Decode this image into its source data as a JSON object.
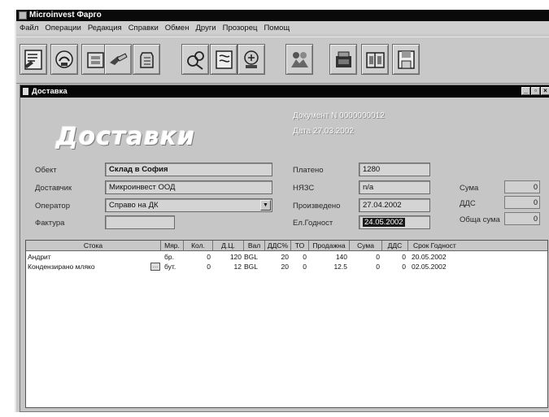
{
  "app": {
    "title": "Microinvest Фарго"
  },
  "menu": [
    "Файл",
    "Операции",
    "Редакция",
    "Справки",
    "Обмен",
    "Други",
    "Прозорец",
    "Помощ"
  ],
  "toolbar_icons": [
    "sales-icon",
    "delivery-icon",
    "refund-icon",
    "payment-icon",
    "stock-icon",
    "production-icon",
    "order-icon",
    "revision-icon",
    "partners-icon",
    "register-icon",
    "ledger-icon",
    "exit-icon"
  ],
  "window": {
    "title": "Доставка",
    "heading": "Доставки",
    "doc_number": "Документ N 0000000012",
    "doc_date": "Дата 27.03.2002"
  },
  "form": {
    "object_label": "Обект",
    "object_value": "Склад в София",
    "supplier_label": "Доставчик",
    "supplier_value": "Микроинвест ООД",
    "operator_label": "Оператор",
    "operator_value": "Справо на ДК",
    "invoice_label": "Фактура",
    "invoice_value": "",
    "paid_label": "Платено",
    "paid_value": "1280",
    "vat_label": "НЯЗС",
    "vat_value": "n/a",
    "produced_label": "Произведено",
    "produced_value": "27.04.2002",
    "valid_label": "Ел.Годност",
    "valid_value": "24.05.2002",
    "sum_label": "Сума",
    "sum_value": "0",
    "dds_label": "ДДС",
    "dds_value": "0",
    "total_label": "Обща сума",
    "total_value": "0"
  },
  "grid": {
    "columns": [
      "Стока",
      "Мяр.",
      "Кол.",
      "Д.Ц.",
      "Вал",
      "ДДС%",
      "ТО",
      "Продажна",
      "Сума",
      "ДДС",
      "Срок Годност"
    ],
    "rows": [
      [
        "Андрит",
        "бр.",
        "0",
        "120",
        "BGL",
        "20",
        "0",
        "140",
        "0",
        "0",
        "20.05.2002"
      ],
      [
        "Кондензирано мляко",
        "бут.",
        "0",
        "12",
        "BGL",
        "20",
        "0",
        "12.5",
        "0",
        "0",
        "02.05.2002"
      ]
    ]
  }
}
